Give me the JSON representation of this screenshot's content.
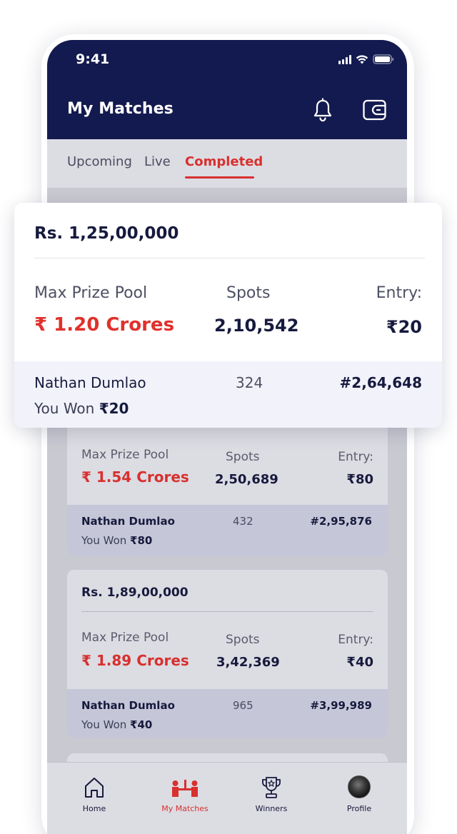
{
  "status": {
    "time": "9:41"
  },
  "header": {
    "title": "My Matches"
  },
  "tabs": [
    {
      "label": "Upcoming"
    },
    {
      "label": "Live"
    },
    {
      "label": "Completed",
      "active": true
    }
  ],
  "highlighted_card": {
    "prize_title": "Rs. 1,25,00,000",
    "pool_label": "Max Prize Pool",
    "pool_value": "₹ 1.20 Crores",
    "spots_label": "Spots",
    "spots_value": "2,10,542",
    "entry_label": "Entry:",
    "entry_value": "₹20",
    "user_name": "Nathan Dumlao",
    "user_points": "324",
    "user_rank": "#2,64,648",
    "won_prefix": "You Won ",
    "won_amount": "₹20"
  },
  "cards": [
    {
      "prize_title": "",
      "pool_label": "Max Prize Pool",
      "pool_value": "₹ 1.54 Crores",
      "spots_label": "Spots",
      "spots_value": "2,50,689",
      "entry_label": "Entry:",
      "entry_value": "₹80",
      "user_name": "Nathan Dumlao",
      "user_points": "432",
      "user_rank": "#2,95,876",
      "won_prefix": "You Won ",
      "won_amount": "₹80"
    },
    {
      "prize_title": "Rs. 1,89,00,000",
      "pool_label": "Max Prize Pool",
      "pool_value": "₹ 1.89 Crores",
      "spots_label": "Spots",
      "spots_value": "3,42,369",
      "entry_label": "Entry:",
      "entry_value": "₹40",
      "user_name": "Nathan Dumlao",
      "user_points": "965",
      "user_rank": "#3,99,989",
      "won_prefix": "You Won ",
      "won_amount": "₹40"
    }
  ],
  "bottom_nav": [
    {
      "label": "Home",
      "icon": "home-icon"
    },
    {
      "label": "My Matches",
      "icon": "matches-icon",
      "active": true
    },
    {
      "label": "Winners",
      "icon": "trophy-icon"
    },
    {
      "label": "Profile",
      "icon": "avatar"
    }
  ],
  "colors": {
    "header": "#131a4f",
    "accent": "#d8302e"
  }
}
